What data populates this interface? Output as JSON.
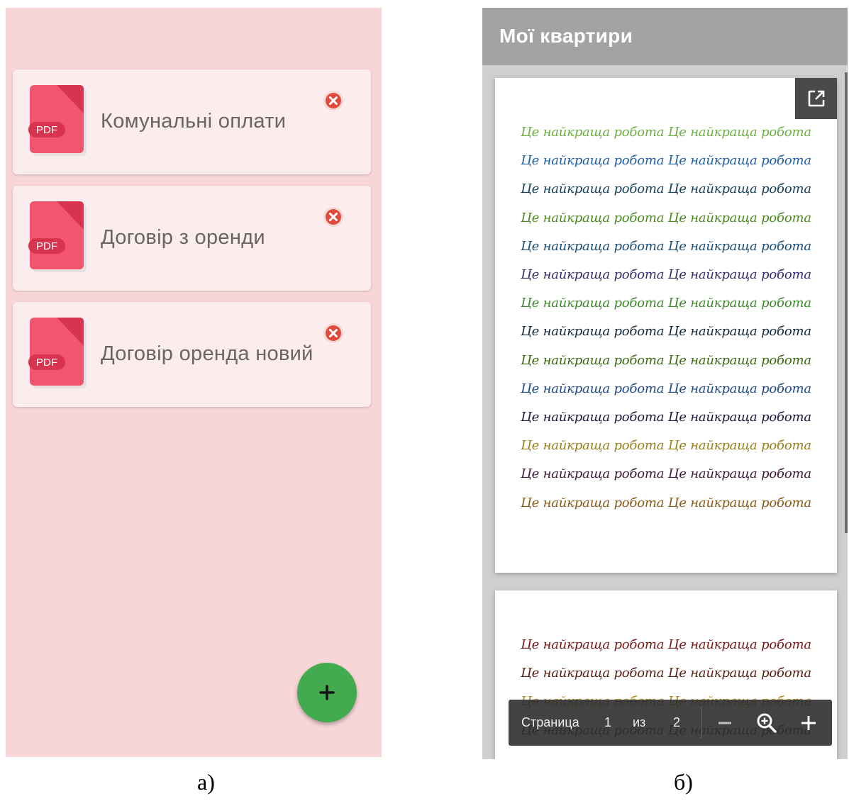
{
  "panel_a": {
    "files": [
      {
        "name": "Комунальні оплати",
        "icon_label": "PDF"
      },
      {
        "name": "Договір з оренди",
        "icon_label": "PDF"
      },
      {
        "name": "Договір оренда новий",
        "icon_label": "PDF"
      }
    ],
    "fab_icon": "plus-icon",
    "caption": "а)"
  },
  "panel_b": {
    "title": "Мої квартири",
    "page_1_lines": [
      {
        "text": "Це найкраща робота Це найкраща робота",
        "color": "#6bb040"
      },
      {
        "text": "Це найкраща робота Це найкраща робота",
        "color": "#1e5fa8"
      },
      {
        "text": "Це найкраща робота Це найкраща робота",
        "color": "#14405a"
      },
      {
        "text": "Це найкраща робота Це найкраща робота",
        "color": "#4a8a1c"
      },
      {
        "text": "Це найкраща робота Це найкраща робота",
        "color": "#1b4f78"
      },
      {
        "text": "Це найкраща робота Це найкраща робота",
        "color": "#3b2a6e"
      },
      {
        "text": "Це найкраща робота Це найкраща робота",
        "color": "#3c8a2c"
      },
      {
        "text": "Це найкраща робота Це найкраща робота",
        "color": "#142a3c"
      },
      {
        "text": "Це найкраща робота Це найкраща робота",
        "color": "#3e6a12"
      },
      {
        "text": "Це найкраща робота Це найкраща робота",
        "color": "#1e4a88"
      },
      {
        "text": "Це найкраща робота Це найкраща робота",
        "color": "#1a1a40"
      },
      {
        "text": "Це найкраща робота Це найкраща робота",
        "color": "#9a8018"
      },
      {
        "text": "Це найкраща робота Це найкраща робота",
        "color": "#401838"
      },
      {
        "text": "Це найкраща робота Це найкраща робота",
        "color": "#8a5a14"
      }
    ],
    "page_2_lines": [
      {
        "text": "Це найкраща робота Це найкраща робота",
        "color": "#7a1616"
      },
      {
        "text": "Це найкраща робота Це найкраща робота",
        "color": "#5a2016"
      },
      {
        "text": "Це найкраща робота Це найкраща робота",
        "color": "#b88418"
      },
      {
        "text": "Це найкраща робота Це найкраща робота",
        "color": "#3a2a40"
      }
    ],
    "toolbar": {
      "page_label": "Страница",
      "current_page": "1",
      "of_label": "из",
      "total_pages": "2"
    },
    "caption": "б)"
  },
  "colors": {
    "panel_a_bg": "#f8d6d7",
    "card_bg": "#fbeced",
    "pdf_red": "#f2566e",
    "delete_red": "#e04a3c",
    "fab_green": "#42aa4f",
    "appbar_gray": "#a3a3a3"
  }
}
